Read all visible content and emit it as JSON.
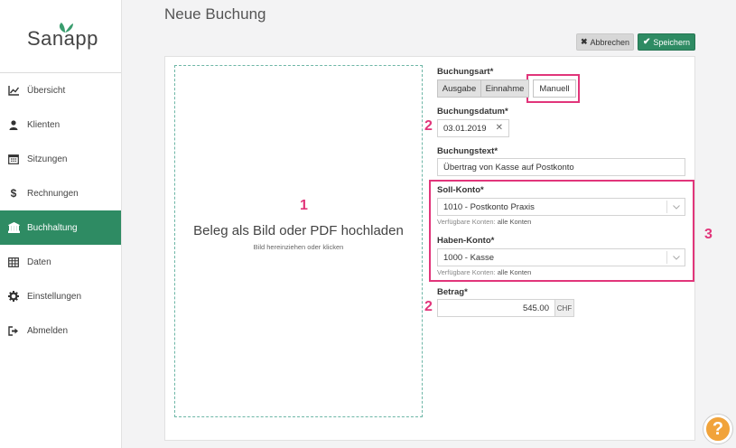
{
  "app": {
    "logo_text": "Sanapp"
  },
  "sidebar": {
    "items": [
      {
        "label": "Übersicht",
        "icon": "chart-line-icon"
      },
      {
        "label": "Klienten",
        "icon": "user-icon"
      },
      {
        "label": "Sitzungen",
        "icon": "calendar-icon"
      },
      {
        "label": "Rechnungen",
        "icon": "dollar-icon"
      },
      {
        "label": "Buchhaltung",
        "icon": "bank-icon",
        "active": true
      },
      {
        "label": "Daten",
        "icon": "table-icon"
      },
      {
        "label": "Einstellungen",
        "icon": "gear-icon"
      },
      {
        "label": "Abmelden",
        "icon": "sign-out-icon"
      }
    ]
  },
  "page": {
    "title": "Neue Buchung"
  },
  "toolbar": {
    "cancel_label": "Abbrechen",
    "save_label": "Speichern"
  },
  "upload": {
    "title": "Beleg als Bild oder PDF hochladen",
    "subtitle": "Bild hereinziehen oder klicken"
  },
  "annotations": {
    "a1": "1",
    "a2a": "2",
    "a2b": "2",
    "a3": "3"
  },
  "form": {
    "buchungsart_label": "Buchungsart*",
    "buchungsart_options": [
      "Ausgabe",
      "Einnahme",
      "Manuell"
    ],
    "buchungsart_selected": "Manuell",
    "datum_label": "Buchungsdatum*",
    "datum_value": "03.01.2019",
    "text_label": "Buchungstext*",
    "text_value": "Übertrag von Kasse auf Postkonto",
    "soll_label": "Soll-Konto*",
    "soll_value": "1010 - Postkonto Praxis",
    "soll_hint_prefix": "Verfügbare Konten:",
    "soll_hint_value": "alle Konten",
    "haben_label": "Haben-Konto*",
    "haben_value": "1000 - Kasse",
    "haben_hint_prefix": "Verfügbare Konten:",
    "haben_hint_value": "alle Konten",
    "betrag_label": "Betrag*",
    "betrag_value": "545.00",
    "currency": "CHF"
  },
  "help": {
    "label": "?"
  },
  "colors": {
    "accent": "#2e8b63",
    "annotation": "#e1357a",
    "help": "#f1a33a"
  }
}
